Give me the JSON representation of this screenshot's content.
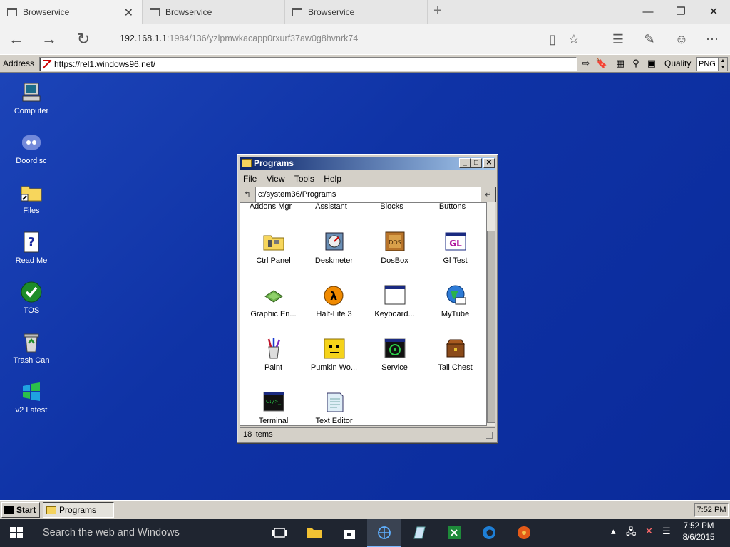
{
  "browser": {
    "tabs": [
      {
        "title": "Browservice"
      },
      {
        "title": "Browservice"
      },
      {
        "title": "Browservice"
      }
    ],
    "url_host": "192.168.1.1",
    "url_rest": ":1984/136/yzlpmwkacapp0rxurf37aw0g8hvnrk74"
  },
  "toolbar": {
    "address_label": "Address",
    "address_value": "https://rel1.windows96.net/",
    "quality_label": "Quality",
    "quality_value": "PNG"
  },
  "desktop": {
    "icons": [
      {
        "label": "Computer",
        "icon": "computer-icon"
      },
      {
        "label": "Doordisc",
        "icon": "discord-icon"
      },
      {
        "label": "Files",
        "icon": "folder-icon"
      },
      {
        "label": "Read Me",
        "icon": "readme-icon"
      },
      {
        "label": "TOS",
        "icon": "checkmark-icon"
      },
      {
        "label": "Trash Can",
        "icon": "recycle-bin-icon"
      },
      {
        "label": "v2 Latest",
        "icon": "windows-logo-icon"
      }
    ]
  },
  "programs_window": {
    "title": "Programs",
    "menu": [
      "File",
      "View",
      "Tools",
      "Help"
    ],
    "path": "c:/system36/Programs",
    "cut_row": [
      "Addons Mgr",
      "Assistant",
      "Blocks",
      "Buttons"
    ],
    "items": [
      {
        "label": "Ctrl Panel",
        "icon": "control-panel-icon"
      },
      {
        "label": "Deskmeter",
        "icon": "deskmeter-icon"
      },
      {
        "label": "DosBox",
        "icon": "dosbox-icon"
      },
      {
        "label": "Gl Test",
        "icon": "gl-test-icon"
      },
      {
        "label": "Graphic En...",
        "icon": "graphic-engine-icon"
      },
      {
        "label": "Half-Life 3",
        "icon": "half-life-icon"
      },
      {
        "label": "Keyboard...",
        "icon": "keyboard-window-icon"
      },
      {
        "label": "MyTube",
        "icon": "mytube-globe-icon"
      },
      {
        "label": "Paint",
        "icon": "paint-brushes-icon"
      },
      {
        "label": "Pumkin Wo...",
        "icon": "pumpkin-face-icon"
      },
      {
        "label": "Service",
        "icon": "biohazard-icon"
      },
      {
        "label": "Tall Chest",
        "icon": "chest-icon"
      },
      {
        "label": "Terminal",
        "icon": "terminal-icon"
      },
      {
        "label": "Text Editor",
        "icon": "notepad-icon"
      }
    ],
    "status": "18 items"
  },
  "w96_taskbar": {
    "start_label": "Start",
    "task_label": "Programs",
    "time": "7:52 PM"
  },
  "win10_taskbar": {
    "search_placeholder": "Search the web and Windows",
    "time": "7:52 PM",
    "date": "8/6/2015"
  }
}
